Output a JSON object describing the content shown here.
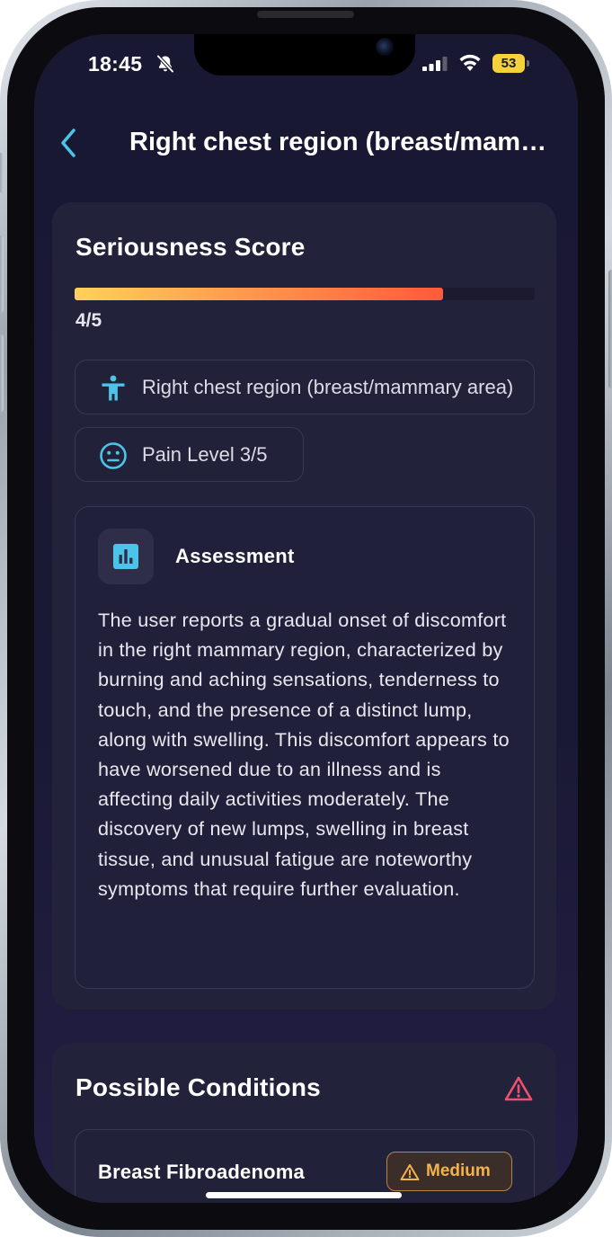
{
  "status_bar": {
    "time": "18:45",
    "battery": "53"
  },
  "header": {
    "title": "Right chest region (breast/mammary area)"
  },
  "seriousness": {
    "title": "Seriousness Score",
    "score_text": "4/5",
    "score_fraction": 0.8,
    "gradient_colors": [
      "#ffd15a",
      "#ff9a4d",
      "#ff5a39"
    ]
  },
  "chips": {
    "location": "Right chest region (breast/mammary area)",
    "pain": "Pain Level 3/5"
  },
  "assessment": {
    "title": "Assessment",
    "text": "The user reports a gradual onset of discomfort in the right mammary region, characterized by burning and aching sensations, tenderness to touch, and the presence of a distinct lump, along with swelling. This discomfort appears to have worsened due to an illness and is affecting daily activities moderately. The discovery of new lumps, swelling in breast tissue, and unusual fatigue are noteworthy symptoms that require further evaluation."
  },
  "conditions": {
    "title": "Possible Conditions",
    "items": [
      {
        "name": "Breast Fibroadenoma",
        "severity": "Medium",
        "severity_color": "#f4b24a"
      }
    ]
  },
  "colors": {
    "accent": "#4cc3e8",
    "warning": "#f0506e",
    "background": "#191833",
    "card": "#23223b"
  }
}
